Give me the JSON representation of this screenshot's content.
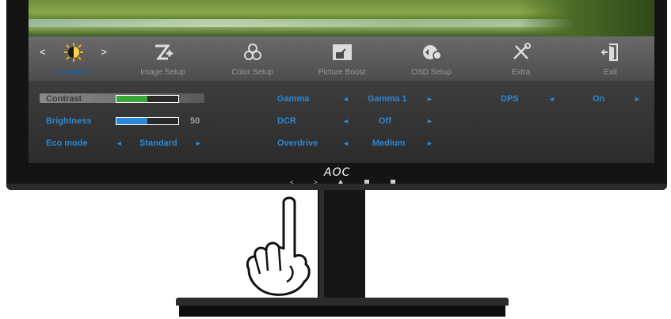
{
  "tabs": [
    {
      "label": "Luminance",
      "active": true
    },
    {
      "label": "Image Setup"
    },
    {
      "label": "Color Setup"
    },
    {
      "label": "Picture Boost"
    },
    {
      "label": "OSD Setup"
    },
    {
      "label": "Extra"
    },
    {
      "label": "Exit"
    }
  ],
  "tab_arrows": {
    "left": "<",
    "right": ">"
  },
  "settings": {
    "contrast": {
      "label": "Contrast",
      "value": "50",
      "level": 0.5
    },
    "brightness": {
      "label": "Brightness",
      "value": "50",
      "level": 0.5
    },
    "eco_mode": {
      "label": "Eco mode",
      "value": "Standard"
    },
    "gamma": {
      "label": "Gamma",
      "value": "Gamma 1"
    },
    "dcr": {
      "label": "DCR",
      "value": "Off"
    },
    "overdrive": {
      "label": "Overdrive",
      "value": "Medium"
    },
    "dps": {
      "label": "DPS",
      "value": "On"
    }
  },
  "arrows": {
    "left": "◄",
    "right": "►"
  },
  "brand": {
    "logo": "AOC"
  },
  "buttons": {
    "left": "<",
    "right": ">"
  },
  "colors": {
    "accent": "#2c88d6",
    "contrast_fill": "#3aa635",
    "brightness_fill": "#2c88d6"
  }
}
